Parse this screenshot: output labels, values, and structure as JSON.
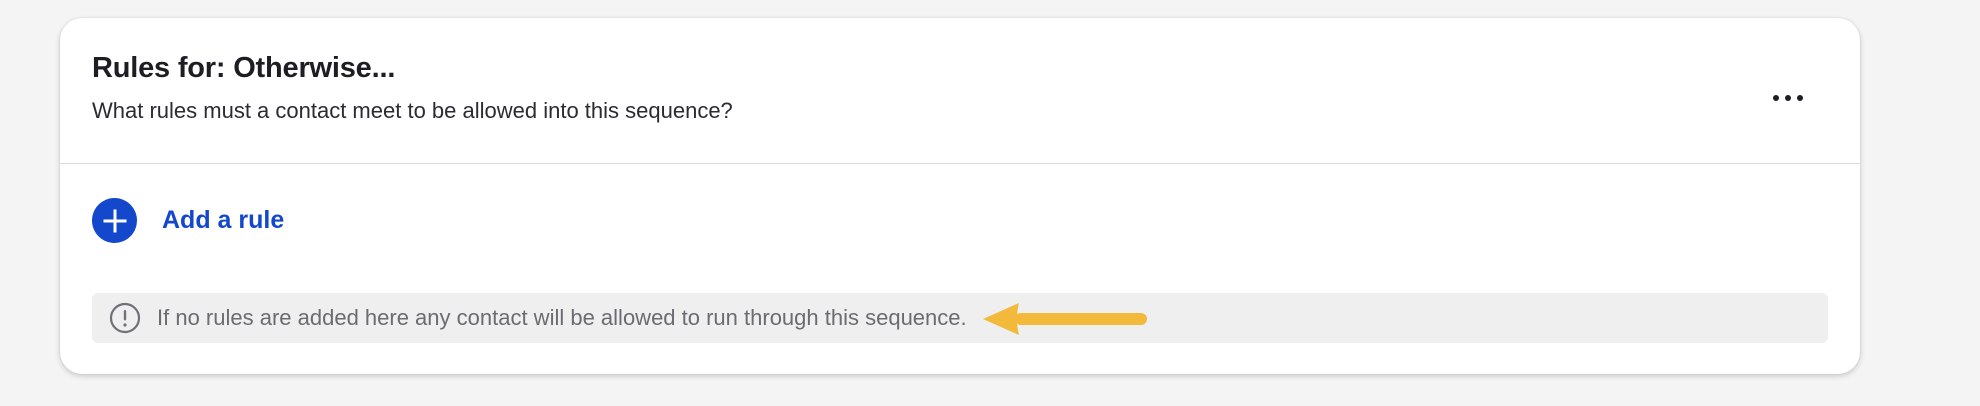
{
  "card": {
    "title": "Rules for: Otherwise...",
    "subtitle": "What rules must a contact meet to be allowed into this sequence?",
    "more_icon": "ellipsis-icon"
  },
  "add_rule": {
    "icon": "plus-circle-icon",
    "label": "Add a rule"
  },
  "notice": {
    "icon": "exclamation-circle-icon",
    "text": "If no rules are added here any contact will be allowed to run through this sequence."
  },
  "annotation": {
    "icon": "arrow-left-annotation",
    "color": "#f2b93b"
  },
  "colors": {
    "accent": "#1448cc",
    "background": "#f4f4f4",
    "card": "#ffffff",
    "notice_bg": "#efefef"
  }
}
